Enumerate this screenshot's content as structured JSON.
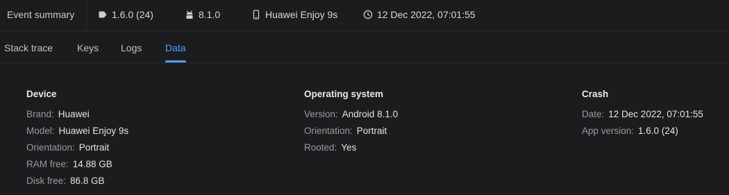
{
  "summary": {
    "title": "Event summary",
    "app_version": "1.6.0 (24)",
    "os_version": "8.1.0",
    "device_name": "Huawei Enjoy 9s",
    "event_time": "12 Dec 2022, 07:01:55"
  },
  "tabs": [
    {
      "label": "Stack trace",
      "active": false
    },
    {
      "label": "Keys",
      "active": false
    },
    {
      "label": "Logs",
      "active": false
    },
    {
      "label": "Data",
      "active": true
    }
  ],
  "accent_color": "#4f9dff",
  "sections": {
    "device": {
      "title": "Device",
      "rows": [
        {
          "key": "Brand:",
          "value": "Huawei"
        },
        {
          "key": "Model:",
          "value": "Huawei Enjoy 9s"
        },
        {
          "key": "Orientation:",
          "value": "Portrait"
        },
        {
          "key": "RAM free:",
          "value": "14.88 GB"
        },
        {
          "key": "Disk free:",
          "value": "86.8 GB"
        }
      ]
    },
    "os": {
      "title": "Operating system",
      "rows": [
        {
          "key": "Version:",
          "value": "Android 8.1.0"
        },
        {
          "key": "Orientation:",
          "value": "Portrait"
        },
        {
          "key": "Rooted:",
          "value": "Yes"
        }
      ]
    },
    "crash": {
      "title": "Crash",
      "rows": [
        {
          "key": "Date:",
          "value": "12 Dec 2022, 07:01:55"
        },
        {
          "key": "App version:",
          "value": "1.6.0 (24)"
        }
      ]
    }
  },
  "icons": {
    "version": "tag-icon",
    "os": "android-icon",
    "device": "smartphone-icon",
    "date": "clock-icon"
  }
}
